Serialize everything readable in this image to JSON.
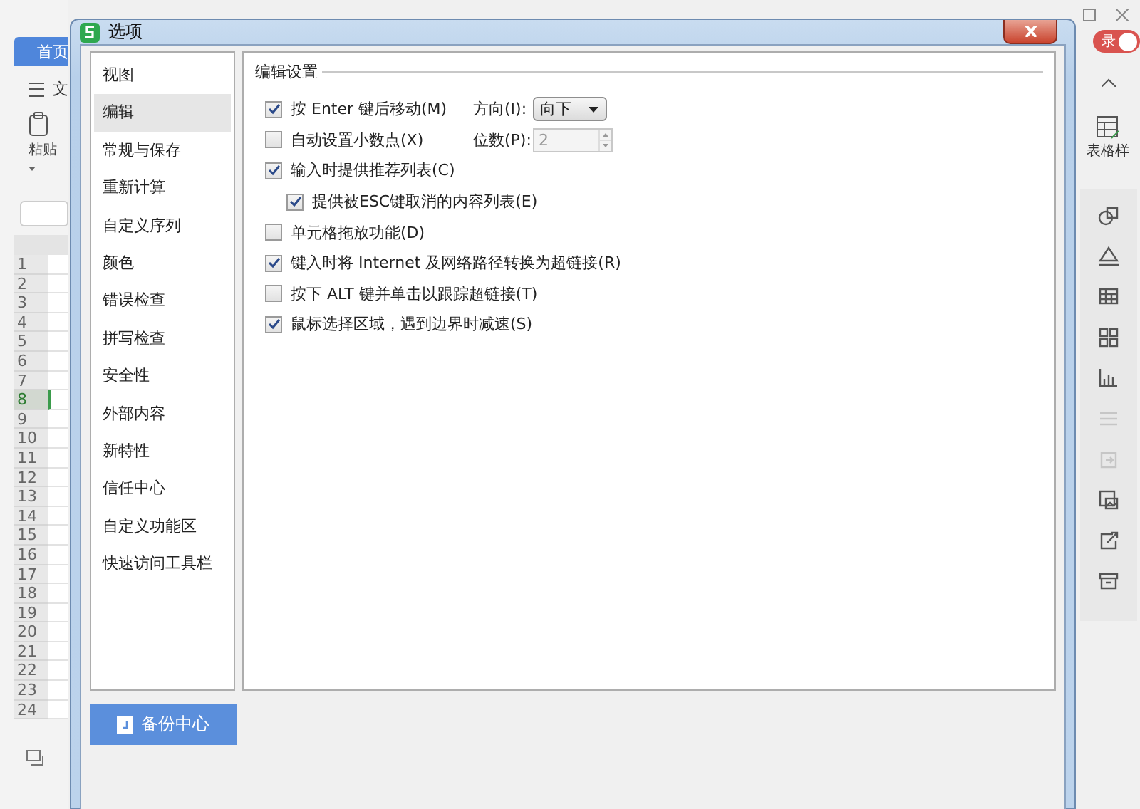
{
  "app": {
    "tab": "首页",
    "menu": "文",
    "paste": "粘贴",
    "login": "录",
    "style_button": "表格样",
    "rows": [
      {
        "label": "1",
        "selected": false
      },
      {
        "label": "2",
        "selected": false
      },
      {
        "label": "3",
        "selected": false
      },
      {
        "label": "4",
        "selected": false
      },
      {
        "label": "5",
        "selected": false
      },
      {
        "label": "6",
        "selected": false
      },
      {
        "label": "7",
        "selected": false
      },
      {
        "label": "8",
        "selected": true
      },
      {
        "label": "9",
        "selected": false
      },
      {
        "label": "10",
        "selected": false
      },
      {
        "label": "11",
        "selected": false
      },
      {
        "label": "12",
        "selected": false
      },
      {
        "label": "13",
        "selected": false
      },
      {
        "label": "14",
        "selected": false
      },
      {
        "label": "15",
        "selected": false
      },
      {
        "label": "16",
        "selected": false
      },
      {
        "label": "17",
        "selected": false
      },
      {
        "label": "18",
        "selected": false
      },
      {
        "label": "19",
        "selected": false
      },
      {
        "label": "20",
        "selected": false
      },
      {
        "label": "21",
        "selected": false
      },
      {
        "label": "22",
        "selected": false
      },
      {
        "label": "23",
        "selected": false
      },
      {
        "label": "24",
        "selected": false
      }
    ],
    "side_tools": [
      {
        "kind": "shape",
        "disabled": false
      },
      {
        "kind": "fill",
        "disabled": false
      },
      {
        "kind": "table",
        "disabled": false
      },
      {
        "kind": "apps",
        "disabled": false
      },
      {
        "kind": "chart",
        "disabled": false
      },
      {
        "kind": "filter",
        "disabled": true
      },
      {
        "kind": "exchange",
        "disabled": true
      },
      {
        "kind": "image",
        "disabled": false
      },
      {
        "kind": "share",
        "disabled": false
      },
      {
        "kind": "archive",
        "disabled": false
      }
    ]
  },
  "dialog": {
    "title": "选项",
    "nav": [
      {
        "label": "视图",
        "selected": false
      },
      {
        "label": "编辑",
        "selected": true
      },
      {
        "label": "常规与保存",
        "selected": false
      },
      {
        "label": "重新计算",
        "selected": false
      },
      {
        "label": "自定义序列",
        "selected": false
      },
      {
        "label": "颜色",
        "selected": false
      },
      {
        "label": "错误检查",
        "selected": false
      },
      {
        "label": "拼写检查",
        "selected": false
      },
      {
        "label": "安全性",
        "selected": false
      },
      {
        "label": "外部内容",
        "selected": false
      },
      {
        "label": "新特性",
        "selected": false
      },
      {
        "label": "信任中心",
        "selected": false
      },
      {
        "label": "自定义功能区",
        "selected": false
      },
      {
        "label": "快速访问工具栏",
        "selected": false
      }
    ],
    "backup_button": "备份中心",
    "section": "编辑设置",
    "options": [
      {
        "label": "按 Enter 键后移动(M)",
        "checked": true,
        "field": {
          "kind": "dropdown",
          "label": "方向(I):",
          "value": "向下",
          "disabled": false
        }
      },
      {
        "label": "自动设置小数点(X)",
        "checked": false,
        "field": {
          "kind": "spinner",
          "label": "位数(P):",
          "value": "2",
          "disabled": true
        }
      },
      {
        "label": "输入时提供推荐列表(C)",
        "checked": true,
        "children": [
          {
            "label": "提供被ESC键取消的内容列表(E)",
            "checked": true
          }
        ]
      },
      {
        "label": "单元格拖放功能(D)",
        "checked": false
      },
      {
        "label": "键入时将 Internet 及网络路径转换为超链接(R)",
        "checked": true
      },
      {
        "label": "按下 ALT 键并单击以跟踪超链接(T)",
        "checked": false
      },
      {
        "label": "鼠标选择区域，遇到边界时减速(S)",
        "checked": true
      }
    ]
  }
}
